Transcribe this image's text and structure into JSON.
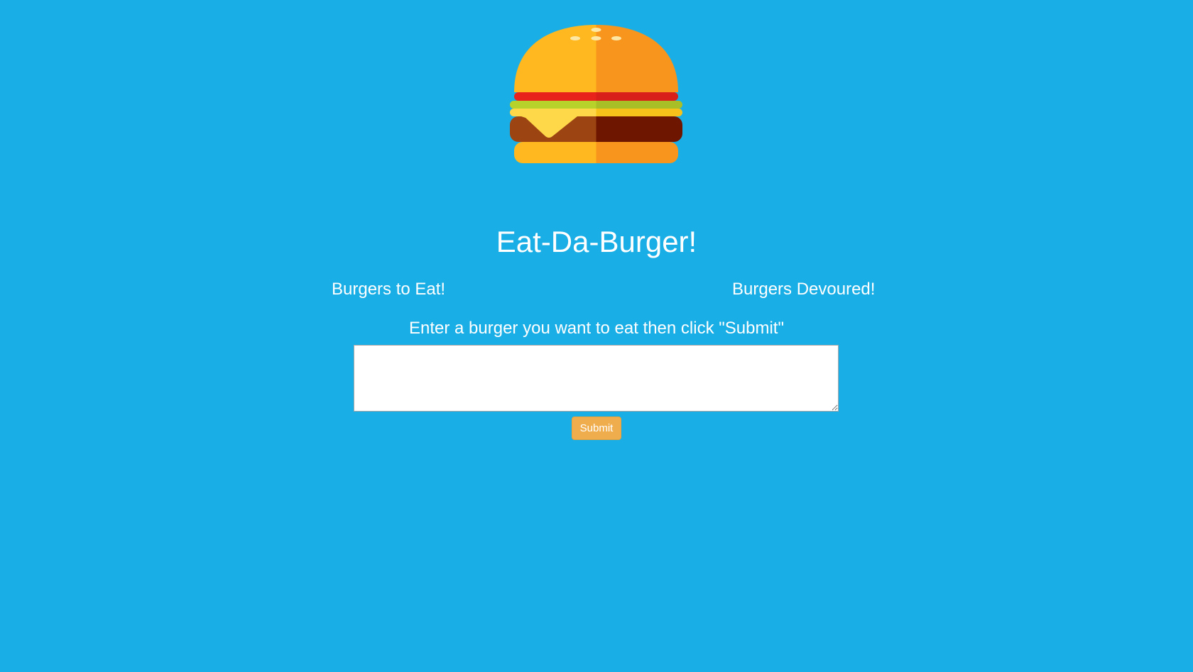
{
  "header": {
    "logo_icon": "burger-icon",
    "title": "Eat-Da-Burger!"
  },
  "columns": {
    "to_eat": "Burgers to Eat!",
    "devoured": "Burgers Devoured!"
  },
  "form": {
    "prompt": "Enter a burger you want to eat then click \"Submit\"",
    "input_value": "",
    "submit_label": "Submit"
  },
  "colors": {
    "background": "#19aee6",
    "submit_button": "#f0ad4e"
  }
}
